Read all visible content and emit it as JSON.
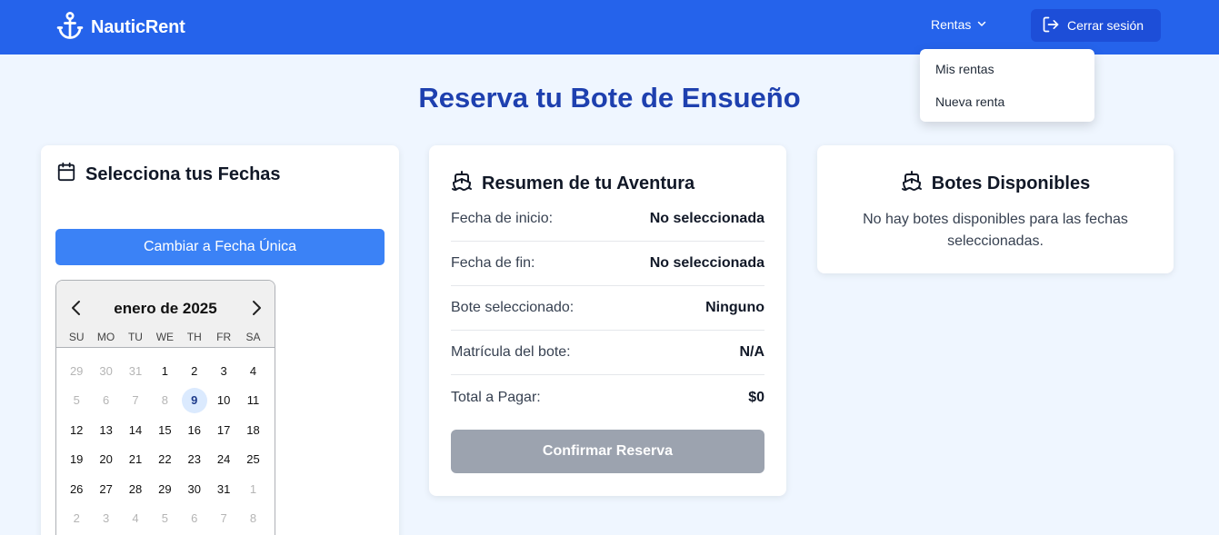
{
  "nav": {
    "brand": "NauticRent",
    "rentas_label": "Rentas",
    "logout_label": "Cerrar sesión",
    "dropdown_items": [
      "Mis rentas",
      "Nueva renta"
    ]
  },
  "page_title": "Reserva tu Bote de Ensueño",
  "dates_card": {
    "title": "Selecciona tus Fechas",
    "toggle_button": "Cambiar a Fecha Única",
    "calendar": {
      "month_label": "enero de 2025",
      "weekdays": [
        "SU",
        "MO",
        "TU",
        "WE",
        "TH",
        "FR",
        "SA"
      ],
      "weeks": [
        [
          "29",
          "30",
          "31",
          "1",
          "2",
          "3",
          "4"
        ],
        [
          "5",
          "6",
          "7",
          "8",
          "9",
          "10",
          "11"
        ],
        [
          "12",
          "13",
          "14",
          "15",
          "16",
          "17",
          "18"
        ],
        [
          "19",
          "20",
          "21",
          "22",
          "23",
          "24",
          "25"
        ],
        [
          "26",
          "27",
          "28",
          "29",
          "30",
          "31",
          "1"
        ],
        [
          "2",
          "3",
          "4",
          "5",
          "6",
          "7",
          "8"
        ]
      ],
      "today": "9"
    }
  },
  "summary_card": {
    "title": "Resumen de tu Aventura",
    "rows": [
      {
        "label": "Fecha de inicio:",
        "value": "No seleccionada"
      },
      {
        "label": "Fecha de fin:",
        "value": "No seleccionada"
      },
      {
        "label": "Bote seleccionado:",
        "value": "Ninguno"
      },
      {
        "label": "Matrícula del bote:",
        "value": "N/A"
      },
      {
        "label": "Total a Pagar:",
        "value": "$0"
      }
    ],
    "confirm_button": "Confirmar Reserva"
  },
  "boats_card": {
    "title": "Botes Disponibles",
    "message": "No hay botes disponibles para las fechas seleccionadas."
  },
  "colors": {
    "navbar": "#2563eb",
    "title": "#1e40af",
    "primary_button": "#3b82f6",
    "disabled_button": "#9ca3af",
    "background": "#eff6ff"
  },
  "icons": {
    "brand": "anchor-icon",
    "rentas": "chevron-down-icon",
    "logout": "log-out-icon",
    "dates": "calendar-icon",
    "summary": "ship-icon",
    "boats": "ship-icon",
    "prev": "chevron-left-icon",
    "next": "chevron-right-icon"
  }
}
